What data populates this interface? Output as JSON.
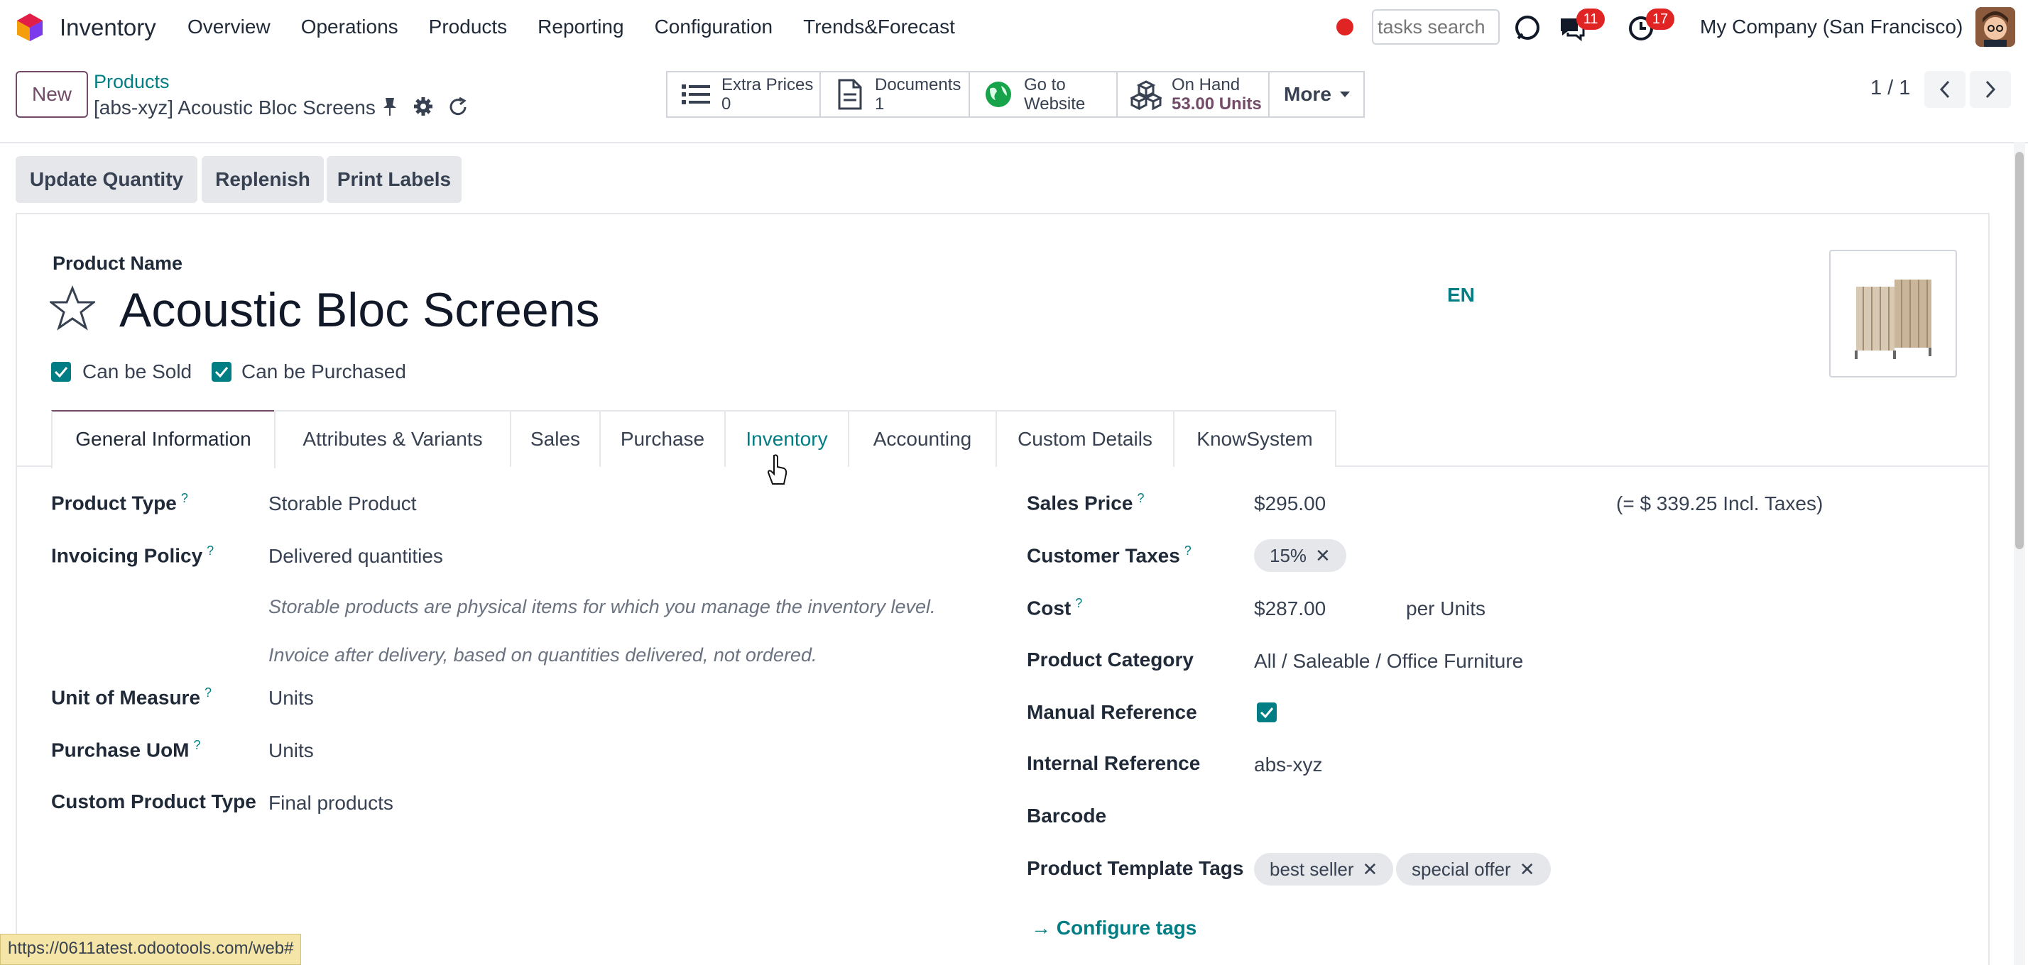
{
  "topnav": {
    "app_name": "Inventory",
    "menu": [
      "Overview",
      "Operations",
      "Products",
      "Reporting",
      "Configuration",
      "Trends&Forecast"
    ],
    "search_placeholder": "tasks search",
    "messages_badge": "11",
    "activities_badge": "17",
    "company": "My Company (San Francisco)"
  },
  "controlbar": {
    "new_label": "New",
    "breadcrumb_parent": "Products",
    "breadcrumb_current": "[abs-xyz] Acoustic Bloc Screens",
    "smart_buttons": {
      "extra_prices_label": "Extra Prices",
      "extra_prices_value": "0",
      "documents_label": "Documents",
      "documents_value": "1",
      "website_line1": "Go to",
      "website_line2": "Website",
      "onhand_label": "On Hand",
      "onhand_value": "53.00 Units",
      "more_label": "More"
    },
    "pager": "1 / 1"
  },
  "statusbar": {
    "buttons": [
      "Update Quantity",
      "Replenish",
      "Print Labels"
    ]
  },
  "form": {
    "product_name_label": "Product Name",
    "product_name": "Acoustic Bloc Screens",
    "lang": "EN",
    "can_be_sold_label": "Can be Sold",
    "can_be_purchased_label": "Can be Purchased",
    "tabs": [
      "General Information",
      "Attributes & Variants",
      "Sales",
      "Purchase",
      "Inventory",
      "Accounting",
      "Custom Details",
      "KnowSystem"
    ],
    "left": {
      "product_type_label": "Product Type",
      "product_type": "Storable Product",
      "invoicing_policy_label": "Invoicing Policy",
      "invoicing_policy": "Delivered quantities",
      "help_storable": "Storable products are physical items for which you manage the inventory level.",
      "help_invoice": "Invoice after delivery, based on quantities delivered, not ordered.",
      "uom_label": "Unit of Measure",
      "uom": "Units",
      "purchase_uom_label": "Purchase UoM",
      "purchase_uom": "Units",
      "custom_type_label": "Custom Product Type",
      "custom_type": "Final products"
    },
    "right": {
      "sales_price_label": "Sales Price",
      "sales_price": "$295.00",
      "incl_taxes": "(= $ 339.25 Incl. Taxes)",
      "customer_taxes_label": "Customer Taxes",
      "customer_tax_tag": "15%",
      "cost_label": "Cost",
      "cost": "$287.00",
      "cost_unit": "per Units",
      "category_label": "Product Category",
      "category": "All / Saleable / Office Furniture",
      "manual_ref_label": "Manual Reference",
      "internal_ref_label": "Internal Reference",
      "internal_ref": "abs-xyz",
      "barcode_label": "Barcode",
      "tags_label": "Product Template Tags",
      "tags": [
        "best seller",
        "special offer"
      ],
      "configure_tags": "Configure tags"
    },
    "help_mark": "?"
  },
  "status_url": "https://0611atest.odootools.com/web#",
  "colors": {
    "primary": "#714B67",
    "accent": "#017e84",
    "badge": "#e02424"
  },
  "icons": [
    "odoo-logo-icon",
    "discuss-icon",
    "messages-icon",
    "activity-clock-icon",
    "pin-icon",
    "gear-icon",
    "refresh-icon",
    "list-icon",
    "document-icon",
    "globe-icon",
    "cubes-icon",
    "star-icon",
    "chevron-left-icon",
    "chevron-right-icon",
    "caret-down-icon",
    "arrow-right-icon",
    "close-icon",
    "check-icon"
  ]
}
